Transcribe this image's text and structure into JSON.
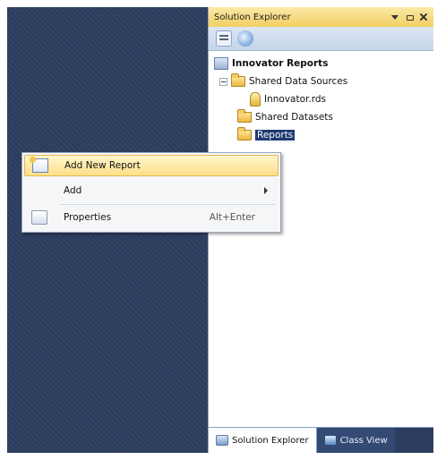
{
  "solution_explorer": {
    "title": "Solution Explorer",
    "tree": {
      "root": "Innovator Reports",
      "shared_data_sources": "Shared Data Sources",
      "datasource_file": "Innovator.rds",
      "shared_datasets": "Shared Datasets",
      "reports": "Reports"
    },
    "tabs": {
      "solution_explorer": "Solution Explorer",
      "class_view": "Class View"
    }
  },
  "context_menu": {
    "items": [
      {
        "label": "Add New Report",
        "shortcut": ""
      },
      {
        "label": "Add",
        "shortcut": ""
      },
      {
        "label": "Properties",
        "shortcut": "Alt+Enter"
      }
    ]
  },
  "colors": {
    "ide_background": "#2c3d5f",
    "titlebar": "#f2cf62",
    "menu_highlight": "#ffe08a",
    "selection": "#1f3a70"
  }
}
